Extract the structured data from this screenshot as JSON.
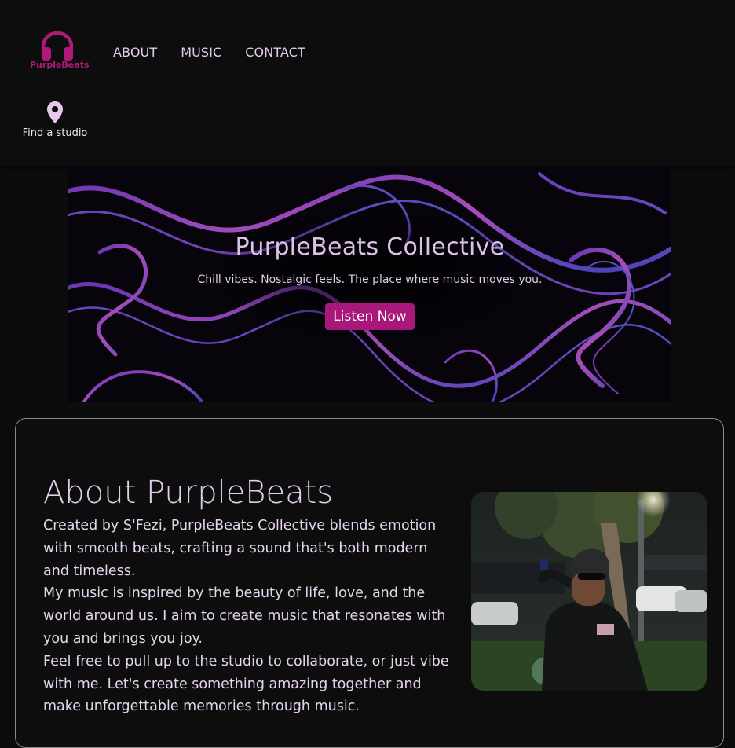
{
  "brand": {
    "name": "PurpleBeats",
    "icon": "headphones-icon",
    "color": "#b0197a"
  },
  "nav": {
    "items": [
      {
        "label": "ABOUT"
      },
      {
        "label": "MUSIC"
      },
      {
        "label": "CONTACT"
      }
    ]
  },
  "studio": {
    "icon": "location-pin-icon",
    "label": "Find a studio"
  },
  "hero": {
    "title": "PurpleBeats Collective",
    "tagline": "Chill vibes. Nostalgic feels. The place where music moves you.",
    "button_label": "Listen Now",
    "button_color": "#a8177a"
  },
  "about": {
    "title": "About PurpleBeats",
    "paragraphs": [
      "Created by S'Fezi, PurpleBeats Collective blends emotion with smooth beats, crafting a sound that's both modern and timeless.",
      "My music is inspired by the beauty of life, love, and the world around us. I aim to create music that resonates with you and brings you joy.",
      "Feel free to pull up to the studio to collaborate, or just vibe with me. Let's create something amazing together and make unforgettable memories through music."
    ]
  }
}
